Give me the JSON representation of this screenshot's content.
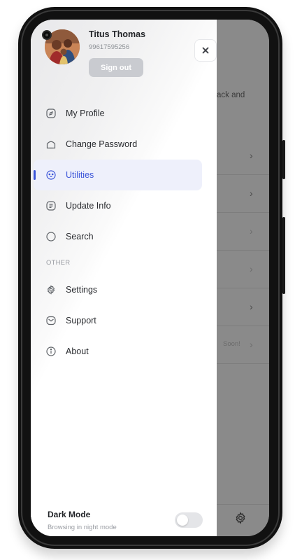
{
  "user": {
    "name": "Titus Thomas",
    "phone": "99617595256",
    "sign_out_label": "Sign out"
  },
  "menu": {
    "items": [
      {
        "label": "My Profile",
        "icon": "compass-icon"
      },
      {
        "label": "Change Password",
        "icon": "home-icon"
      },
      {
        "label": "Utilities",
        "icon": "utilities-icon",
        "active": true
      },
      {
        "label": "Update Info",
        "icon": "document-icon"
      },
      {
        "label": "Search",
        "icon": "circle-icon"
      }
    ],
    "section_other": "OTHER",
    "other_items": [
      {
        "label": "Settings",
        "icon": "gear-icon"
      },
      {
        "label": "Support",
        "icon": "mail-icon"
      },
      {
        "label": "About",
        "icon": "info-icon"
      }
    ]
  },
  "dark_mode": {
    "title": "Dark Mode",
    "subtitle": "Browsing in night mode",
    "enabled": false
  },
  "background": {
    "partial_text": "ack and",
    "row_partial_label": "Soon!"
  },
  "colors": {
    "accent": "#3b55d9",
    "active_bg": "#eef0fb",
    "overlay": "#8a8a8a"
  }
}
